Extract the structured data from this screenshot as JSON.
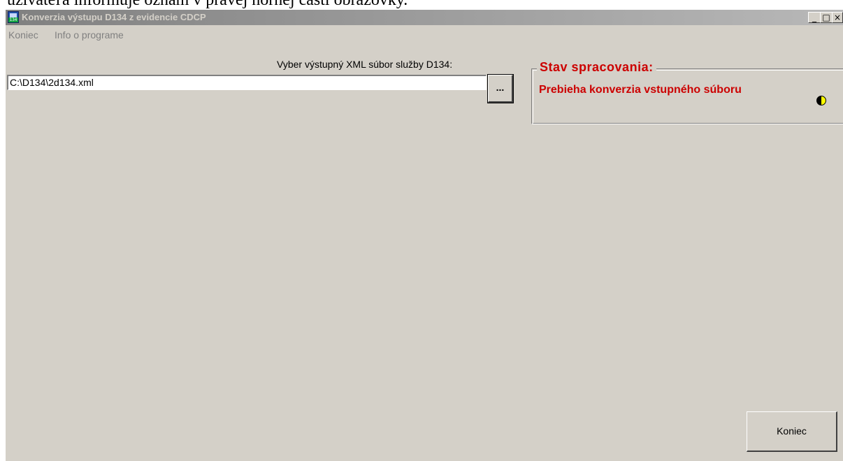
{
  "document_text": "užívateľa informuje oznam v pravej hornej časti obrazovky.",
  "window": {
    "title": "Konverzia výstupu D134 z evidencie CDCP",
    "icon": "app-icon",
    "buttons": {
      "minimize": "_",
      "maximize": "□",
      "close": "×"
    }
  },
  "menu": {
    "items": [
      {
        "label": "Koniec"
      },
      {
        "label": "Info o programe"
      }
    ]
  },
  "file_select": {
    "label": "Vyber výstupný XML súbor služby D134:",
    "value": "C:\\D134\\2d134.xml",
    "browse_label": "..."
  },
  "status": {
    "title": "Stav spracovania:",
    "message": "Prebieha konverzia vstupného súboru",
    "icon": "half-moon-icon",
    "color": "#cc0000"
  },
  "exit_button": {
    "label": "Koniec"
  }
}
